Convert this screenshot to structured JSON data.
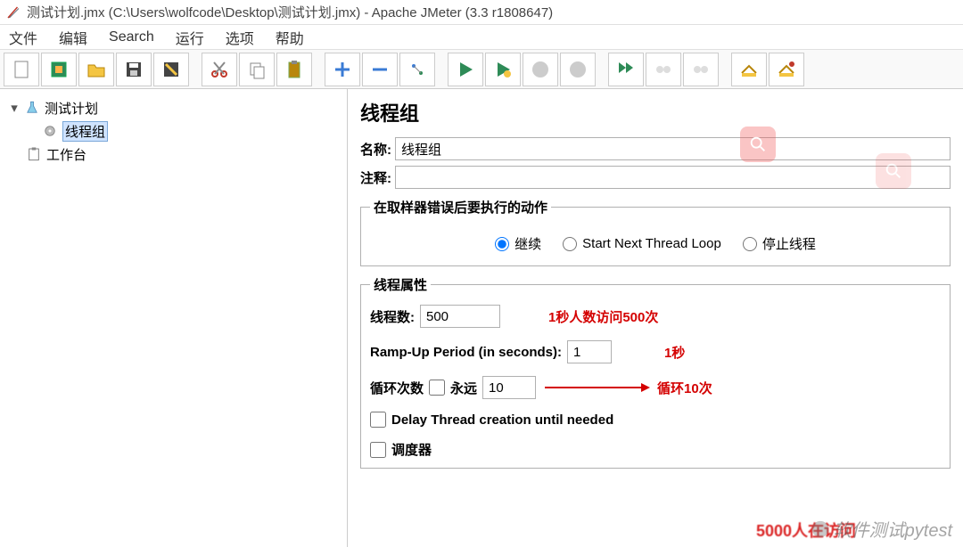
{
  "title": "测试计划.jmx (C:\\Users\\wolfcode\\Desktop\\测试计划.jmx) - Apache JMeter (3.3 r1808647)",
  "menu": {
    "file": "文件",
    "edit": "编辑",
    "search": "Search",
    "run": "运行",
    "options": "选项",
    "help": "帮助"
  },
  "tree": {
    "root": "测试计划",
    "child": "线程组",
    "workbench": "工作台"
  },
  "panel": {
    "heading": "线程组",
    "name_label": "名称:",
    "name_value": "线程组",
    "comment_label": "注释:",
    "comment_value": "",
    "error_action": {
      "legend": "在取样器错误后要执行的动作",
      "continue": "继续",
      "start_next": "Start Next Thread Loop",
      "stop_thread": "停止线程"
    },
    "thread_props": {
      "legend": "线程属性",
      "threads_label": "线程数:",
      "threads_value": "500",
      "threads_note": "1秒人数访问500次",
      "ramp_label": "Ramp-Up Period (in seconds):",
      "ramp_value": "1",
      "ramp_note": "1秒",
      "loop_label": "循环次数",
      "forever_label": "永远",
      "loop_value": "10",
      "loop_note": "循环10次",
      "delay_label": "Delay Thread creation until needed",
      "scheduler_label": "调度器"
    }
  },
  "annotations": {
    "bottom_red": "5000人在访问"
  },
  "watermark": "软件测试pytest"
}
